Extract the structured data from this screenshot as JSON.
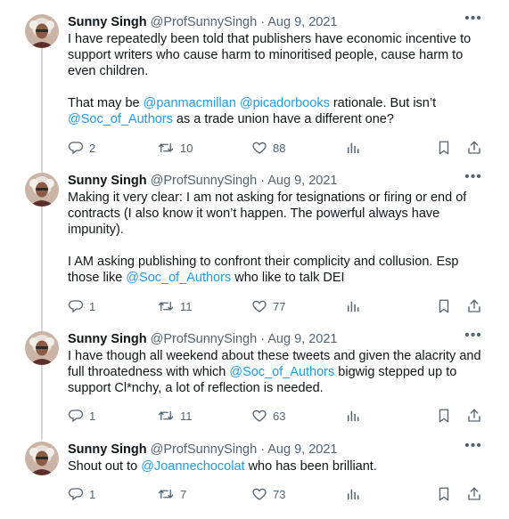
{
  "author": {
    "name": "Sunny Singh",
    "handle": "@ProfSunnySingh",
    "date": "Aug 9, 2021"
  },
  "tweets": [
    {
      "body": [
        [
          {
            "t": "I have repeatedly been told that publishers have economic incentive to support writers who cause harm to minoritised people, cause harm to even children."
          }
        ],
        [
          {
            "t": "That may be "
          },
          {
            "t": "@panmacmillan",
            "link": true
          },
          {
            "t": " "
          },
          {
            "t": "@picadorbooks",
            "link": true
          },
          {
            "t": " rationale. But isn’t "
          },
          {
            "t": "@Soc_of_Authors",
            "link": true
          },
          {
            "t": " as a trade union have a different one?"
          }
        ]
      ],
      "replies": "2",
      "retweets": "10",
      "likes": "88"
    },
    {
      "body": [
        [
          {
            "t": "Making it very clear: I am not asking for tesignations or firing or end of contracts (I also know it won’t happen. The powerful always have impunity)."
          }
        ],
        [
          {
            "t": "I AM asking publishing to confront their complicity and collusion. Esp those like "
          },
          {
            "t": "@Soc_of_Authors",
            "link": true
          },
          {
            "t": " who like to talk DEI"
          }
        ]
      ],
      "replies": "1",
      "retweets": "11",
      "likes": "77"
    },
    {
      "body": [
        [
          {
            "t": "I have though all weekend about these tweets and given the alacrity and full throatedness with which "
          },
          {
            "t": "@Soc_of_Authors",
            "link": true
          },
          {
            "t": " bigwig stepped up to support Cl*nchy, a lot of reflection is needed."
          }
        ]
      ],
      "replies": "1",
      "retweets": "11",
      "likes": "63"
    },
    {
      "body": [
        [
          {
            "t": "Shout out to "
          },
          {
            "t": "@Joannechocolat",
            "link": true
          },
          {
            "t": " who has been brilliant."
          }
        ]
      ],
      "replies": "1",
      "retweets": "7",
      "likes": "73"
    }
  ],
  "colors": {
    "text": "#0f1419",
    "muted": "#536471",
    "link": "#1d9bf0",
    "thread_line": "#cfd9de"
  },
  "icons": {
    "reply": "reply-icon",
    "retweet": "retweet-icon",
    "like": "heart-icon",
    "views": "views-icon",
    "bookmark": "bookmark-icon",
    "share": "share-icon",
    "more": "more-icon"
  }
}
